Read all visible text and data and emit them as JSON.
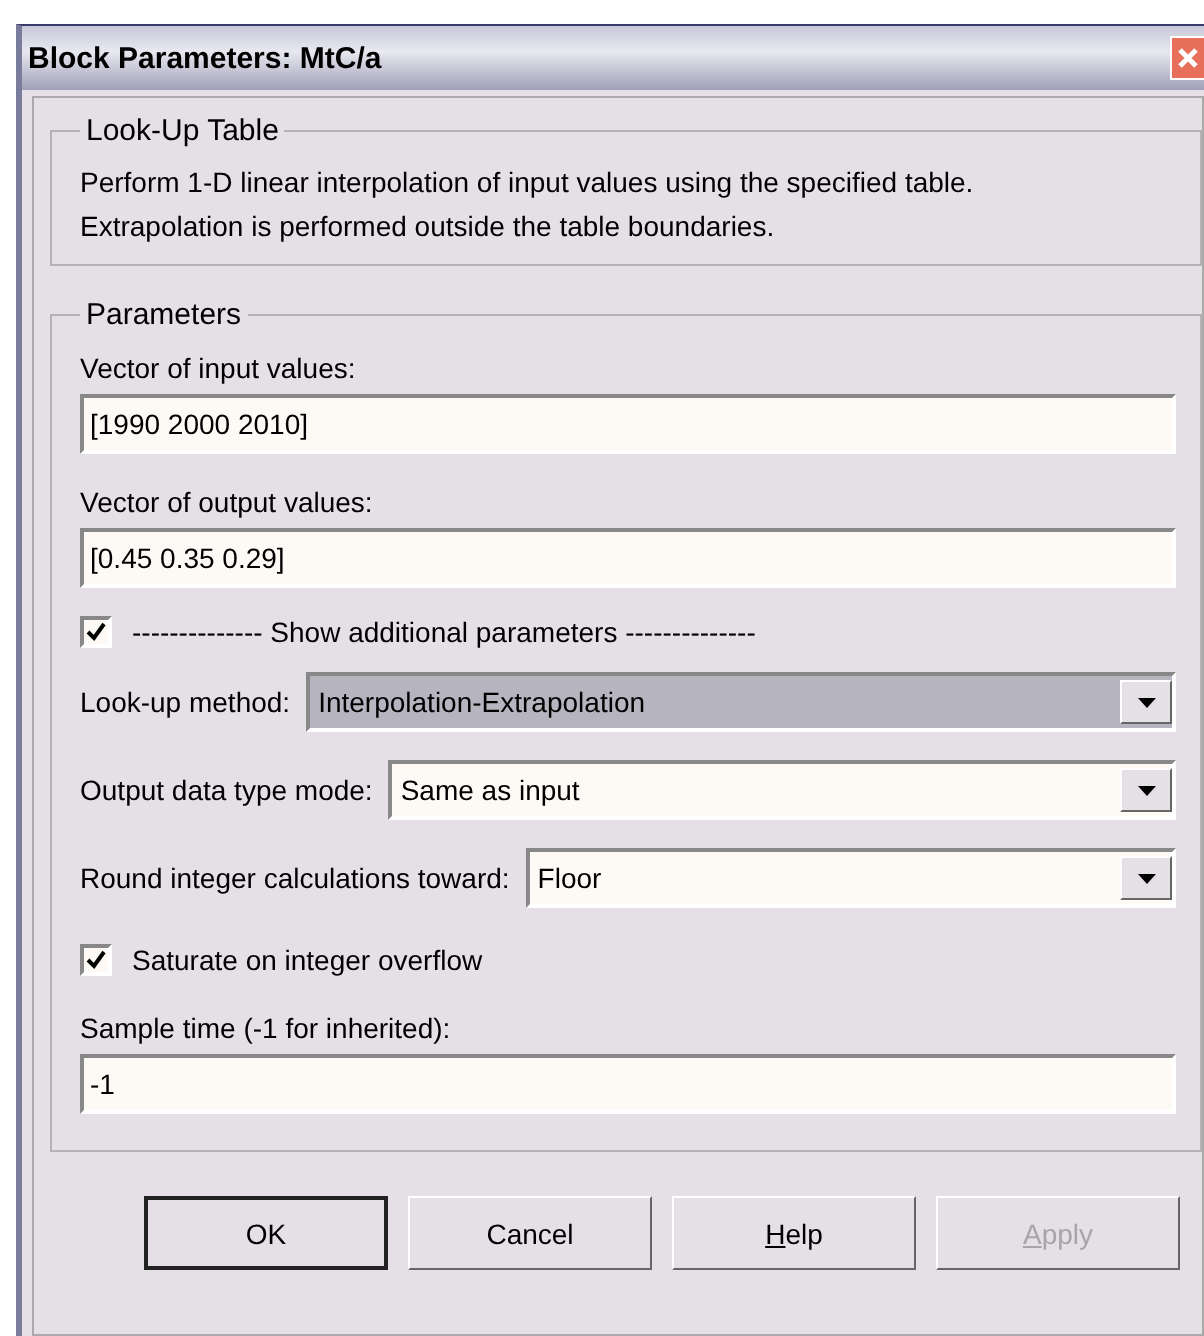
{
  "window": {
    "title": "Block Parameters: MtC/a"
  },
  "description_group": {
    "title": "Look-Up Table",
    "text": "Perform 1-D linear interpolation of input values using the specified table.\nExtrapolation is performed outside the table boundaries."
  },
  "parameters_group": {
    "title": "Parameters",
    "items": [
      {
        "kind": "textfield",
        "label": "Vector of input values:",
        "value": "[1990 2000 2010]"
      },
      {
        "kind": "textfield",
        "label": "Vector of output values:",
        "value": "[0.45 0.35 0.29]"
      },
      {
        "kind": "checkbox",
        "label": "-------------- Show additional parameters --------------",
        "checked": true
      },
      {
        "kind": "dropdown",
        "label": "Look-up method:",
        "value": "Interpolation-Extrapolation",
        "disabled": true
      },
      {
        "kind": "dropdown",
        "label": "Output data type mode:",
        "value": "Same as input",
        "disabled": false
      },
      {
        "kind": "dropdown",
        "label": "Round integer calculations toward:",
        "value": "Floor",
        "disabled": false
      },
      {
        "kind": "checkbox",
        "label": "Saturate on integer overflow",
        "checked": true
      },
      {
        "kind": "textfield",
        "label": "Sample time (-1 for inherited):",
        "value": "-1"
      }
    ]
  },
  "buttons": [
    {
      "label": "OK",
      "default": true,
      "disabled": false
    },
    {
      "label": "Cancel",
      "default": false,
      "disabled": false
    },
    {
      "label": "**H**elp",
      "default": false,
      "disabled": false
    },
    {
      "label": "**A**pply",
      "default": false,
      "disabled": true
    }
  ]
}
